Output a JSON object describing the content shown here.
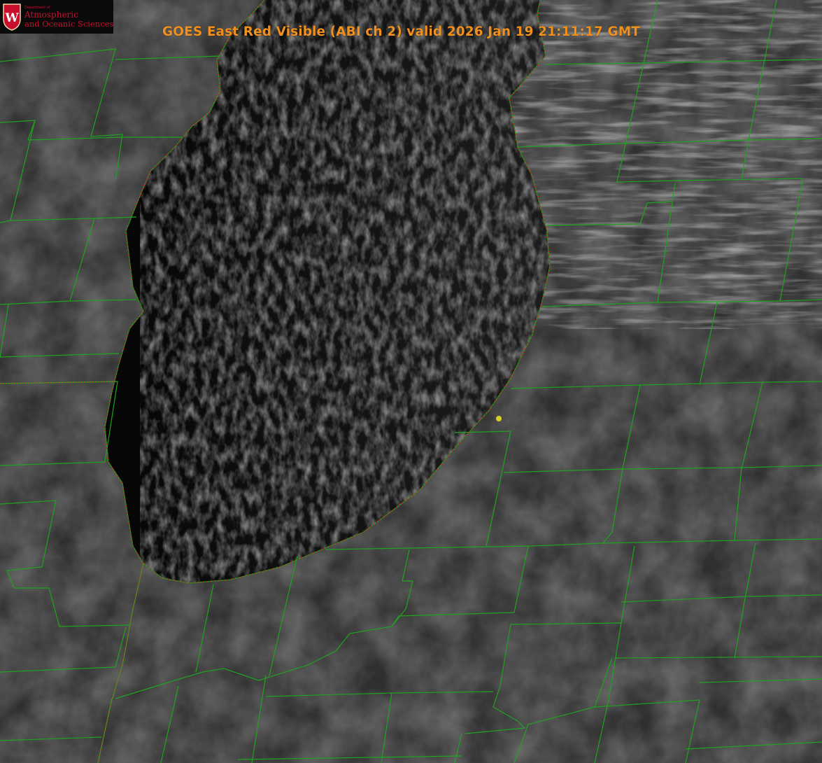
{
  "title": "GOES East Red Visible (ABI ch 2) valid 2026 Jan 19 21:11:17 GMT",
  "logo": {
    "department": "Department of",
    "line1": "Atmospheric",
    "line2": "and Oceanic Sciences",
    "crest_letter": "W"
  },
  "colors": {
    "title": "#f0901e",
    "county_lines": "#1fa31f",
    "shoreline": "#d11a1a",
    "marker": "#d8d21e",
    "land": "#2e2e2e",
    "lake": "#0c0c0c",
    "logo_red": "#c8102e"
  },
  "map": {
    "product": "visible satellite imagery",
    "water_body": "lake with lake-effect cloud streets",
    "overlays": [
      "county-boundaries",
      "state-boundaries",
      "shoreline",
      "location-marker"
    ]
  }
}
